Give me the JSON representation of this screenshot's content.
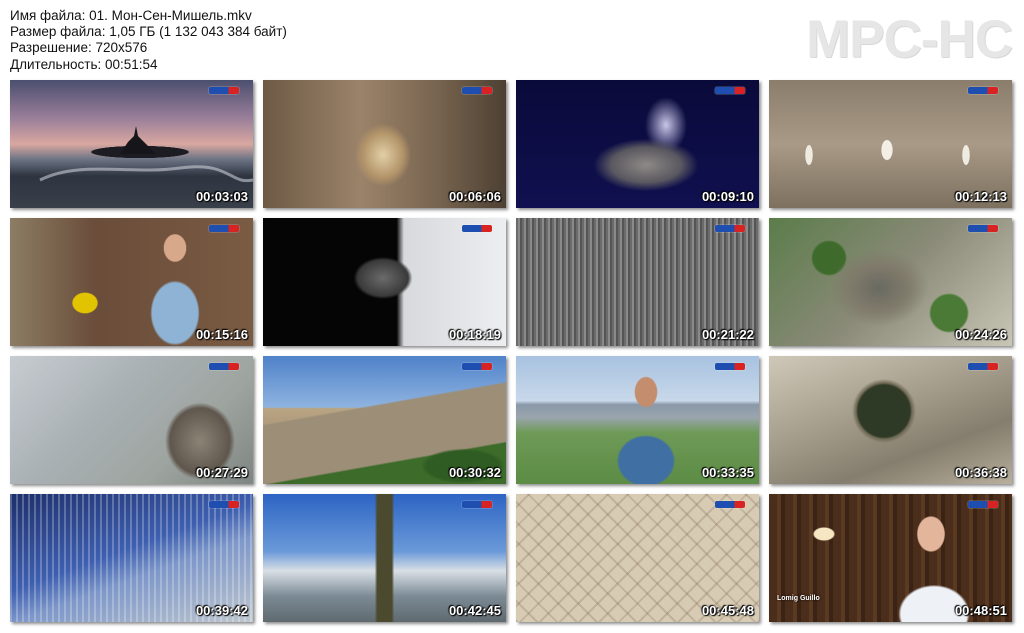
{
  "info": {
    "filename_line": "Имя файла: 01. Мон-Сен-Мишель.mkv",
    "size_line": "Размер файла: 1,05 ГБ (1 132 043 384 байт)",
    "resolution_line": "Разрешение: 720x576",
    "duration_line": "Длительность: 00:51:54"
  },
  "logo": "MPC-HC",
  "thumbnails": [
    {
      "time": "00:03:03",
      "scene": "dusk-abbey"
    },
    {
      "time": "00:06:06",
      "scene": "stone-vault"
    },
    {
      "time": "00:09:10",
      "scene": "pointcloud-island"
    },
    {
      "time": "00:12:13",
      "scene": "church-nave"
    },
    {
      "time": "00:15:16",
      "scene": "presenter-scanner"
    },
    {
      "time": "00:18:19",
      "scene": "scan-model-rock"
    },
    {
      "time": "00:21:22",
      "scene": "pointcloud-texture"
    },
    {
      "time": "00:24:26",
      "scene": "aerial-village"
    },
    {
      "time": "00:27:29",
      "scene": "scan-rampart"
    },
    {
      "time": "00:30:32",
      "scene": "ramparts-town"
    },
    {
      "time": "00:33:35",
      "scene": "interview-dam"
    },
    {
      "time": "00:36:38",
      "scene": "island-top-view"
    },
    {
      "time": "00:39:42",
      "scene": "3d-blocks"
    },
    {
      "time": "00:42:45",
      "scene": "spire-sky"
    },
    {
      "time": "00:45:48",
      "scene": "engraved-drawing"
    },
    {
      "time": "00:48:51",
      "scene": "library-presenter"
    }
  ],
  "caption_12": "Lomig Guillo",
  "colors": {
    "logo": "#e6e6e6",
    "timestamp": "#ffffff"
  }
}
